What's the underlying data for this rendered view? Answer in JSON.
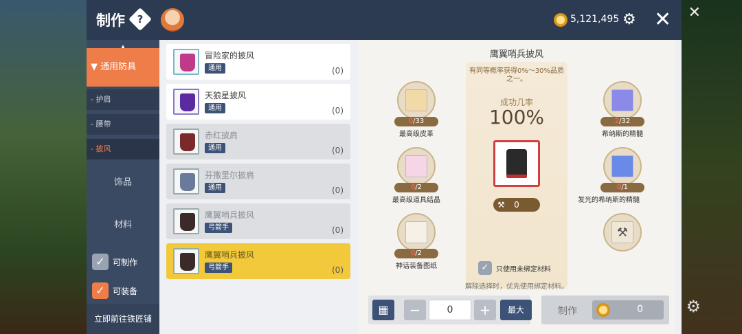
{
  "header": {
    "title": "制作",
    "gold": "5,121,495",
    "close": "✕"
  },
  "categories": {
    "main": "▼  通用防具",
    "subs": [
      "- 护肩",
      "- 腰带",
      "- 披风"
    ],
    "accessories": "饰品",
    "materials": "材料",
    "filter_craftable": "可制作",
    "filter_equippable": "可装备",
    "smith_link": "立即前往铁匠铺"
  },
  "items": [
    {
      "name": "冒险家的披风",
      "tag": "通用",
      "count": "(0)"
    },
    {
      "name": "天狼星披风",
      "tag": "通用",
      "count": "(0)"
    },
    {
      "name": "赤红披肩",
      "tag": "通用",
      "count": "(0)"
    },
    {
      "name": "芬撒里尔披肩",
      "tag": "通用",
      "count": "(0)"
    },
    {
      "name": "鹰翼哨兵披风",
      "tag": "弓箭手",
      "count": "(0)"
    },
    {
      "name": "鹰翼哨兵披风",
      "tag": "弓箭手",
      "count": "(0)"
    }
  ],
  "craft": {
    "title": "鹰翼哨兵披风",
    "note": "有同等概率获得0%～30%品质之一。",
    "rate_label": "成功几率",
    "rate": "100%",
    "result_count": "0",
    "materials": [
      {
        "have": "0",
        "need": "/33",
        "name": "最高级皮革"
      },
      {
        "have": "2",
        "need": "/32",
        "name": "希纳斯的精髓"
      },
      {
        "have": "0",
        "need": "/2",
        "name": "最高级道具结晶"
      },
      {
        "have": "0",
        "need": "/1",
        "name": "发光的希纳斯的精髓"
      },
      {
        "have": "0",
        "need": "/2",
        "name": "神话装备图纸"
      }
    ],
    "use_bound": "只使用未绑定材料",
    "hint": "解除选择时，优先使用绑定材料。",
    "qty": "0",
    "max": "最大",
    "craft_label": "制作",
    "cost": "0"
  }
}
